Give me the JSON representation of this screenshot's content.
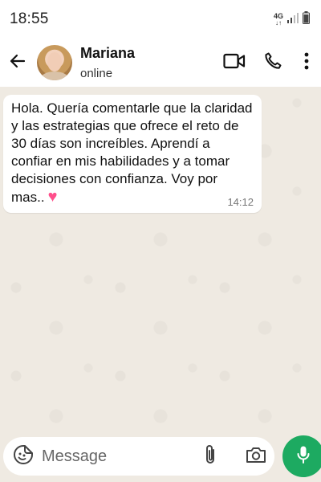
{
  "status_bar": {
    "time": "18:55",
    "network": "4G",
    "network_arrows": "↓↑"
  },
  "header": {
    "contact_name": "Mariana",
    "contact_status": "online",
    "icons": [
      "back-arrow-icon",
      "video-call-icon",
      "phone-icon",
      "more-options-icon"
    ]
  },
  "messages": [
    {
      "text": "Hola. Quería comentarle que la claridad y las estrategias que ofrece el reto de 30 días son increíbles. Aprendí a confiar en mis habilidades y a tomar decisiones con confianza. Voy por mas..",
      "emoji": "♥",
      "time": "14:12",
      "direction": "incoming"
    }
  ],
  "composer": {
    "placeholder": "Message",
    "icons": [
      "sticker-emoji-icon",
      "paperclip-icon",
      "camera-icon",
      "microphone-icon"
    ]
  },
  "colors": {
    "chat_background": "#efeae2",
    "accent_green": "#1daa61",
    "heart_pink": "#ff4f8b"
  }
}
